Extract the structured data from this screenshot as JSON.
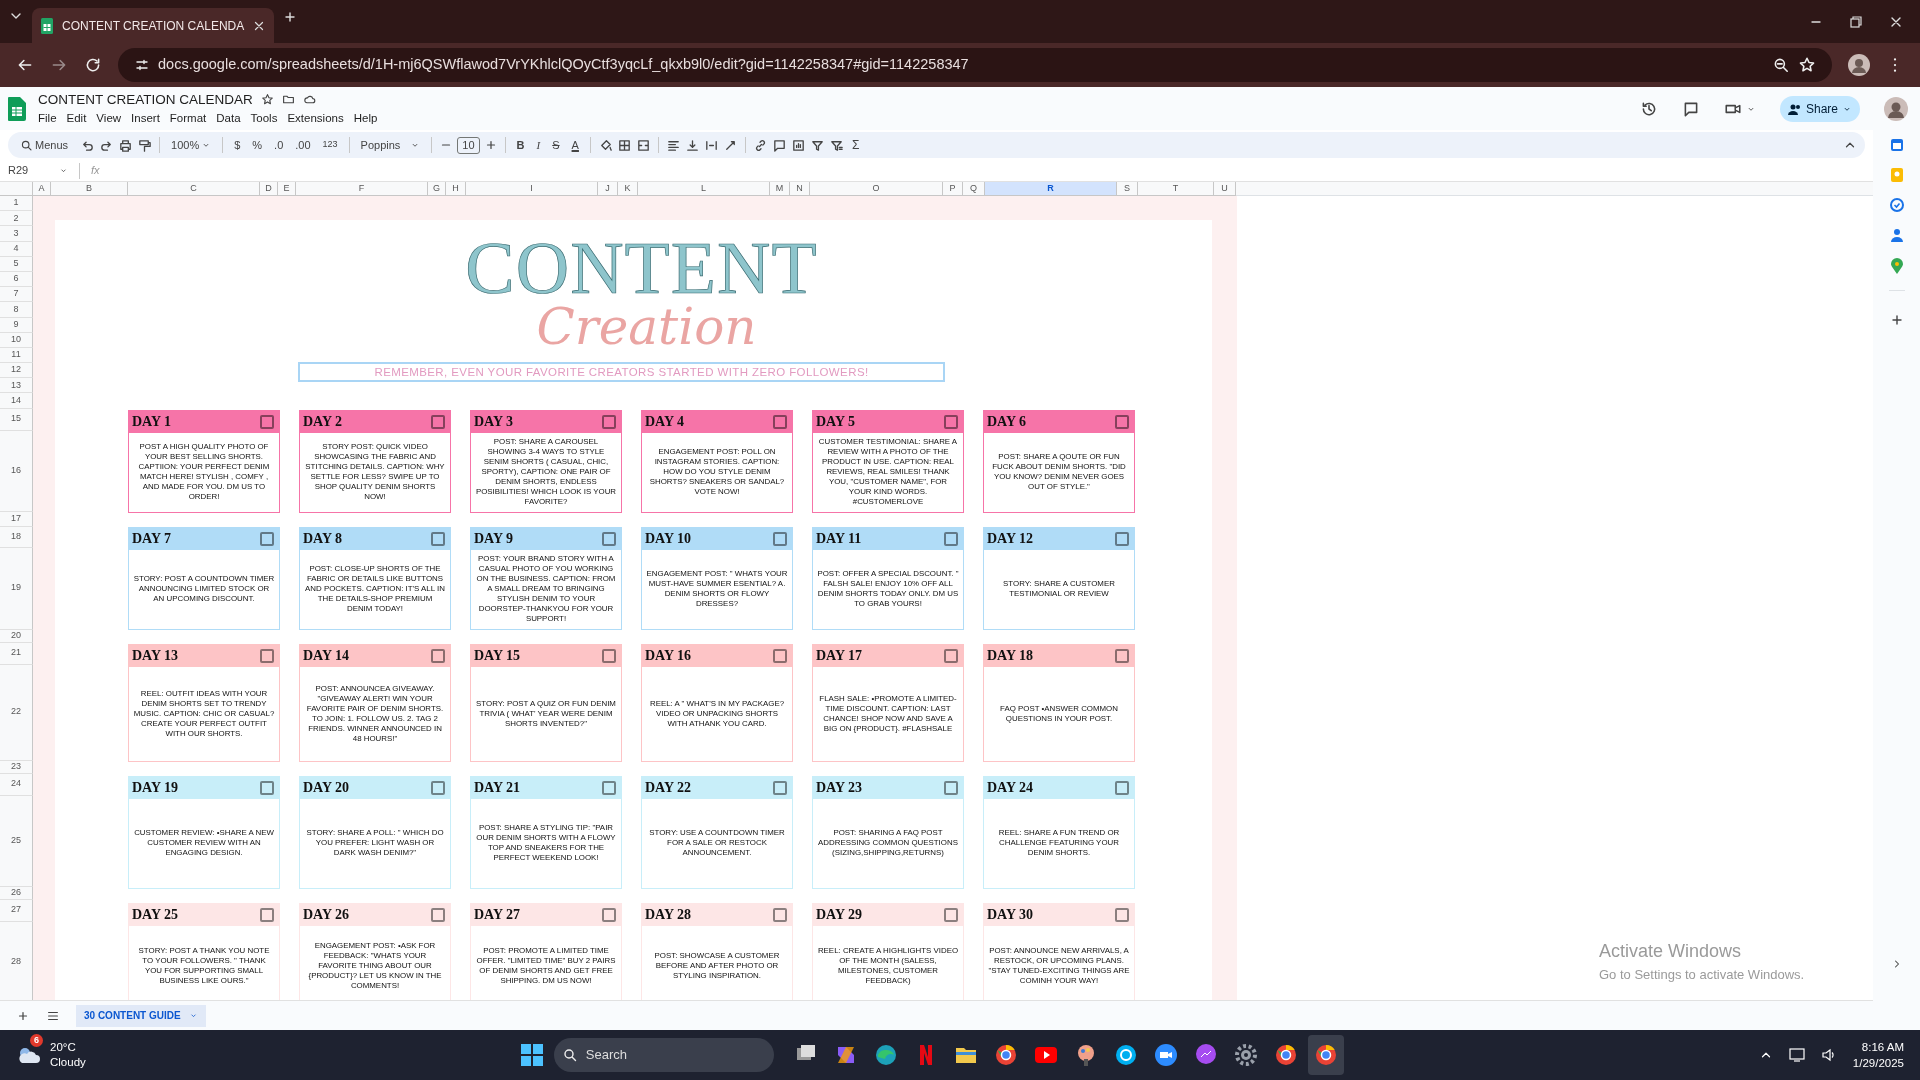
{
  "browser": {
    "tab_title": "CONTENT CREATION CALENDA",
    "url": "docs.google.com/spreadsheets/d/1H-mj6QSWflawod7VrYKhlclQOyCtf3yqcLf_qkxb9l0/edit?gid=1142258347#gid=1142258347"
  },
  "app": {
    "title": "CONTENT CREATION CALENDAR",
    "menu": [
      "File",
      "Edit",
      "View",
      "Insert",
      "Format",
      "Data",
      "Tools",
      "Extensions",
      "Help"
    ],
    "share_label": "Share"
  },
  "toolbar": {
    "search_label": "Menus",
    "zoom": "100%",
    "currency": "$",
    "percent": "%",
    "decrease_decimal": ".0",
    "increase_decimal": ".00",
    "number_format": "123",
    "font": "Poppins",
    "font_size": "10",
    "bold": "B",
    "italic": "I",
    "strikethrough": "S",
    "text_color": "A",
    "functions": "Σ"
  },
  "formula_bar": {
    "cell_ref": "R29",
    "fx": "fx"
  },
  "columns": [
    {
      "label": "A",
      "selected": false
    },
    {
      "label": "B",
      "selected": false
    },
    {
      "label": "C",
      "selected": false
    },
    {
      "label": "D",
      "selected": false
    },
    {
      "label": "E",
      "selected": false
    },
    {
      "label": "F",
      "selected": false
    },
    {
      "label": "G",
      "selected": false
    },
    {
      "label": "H",
      "selected": false
    },
    {
      "label": "I",
      "selected": false
    },
    {
      "label": "J",
      "selected": false
    },
    {
      "label": "K",
      "selected": false
    },
    {
      "label": "L",
      "selected": false
    },
    {
      "label": "M",
      "selected": false
    },
    {
      "label": "N",
      "selected": false
    },
    {
      "label": "O",
      "selected": false
    },
    {
      "label": "P",
      "selected": false
    },
    {
      "label": "Q",
      "selected": false
    },
    {
      "label": "R",
      "selected": true
    },
    {
      "label": "S",
      "selected": false
    },
    {
      "label": "T",
      "selected": false
    },
    {
      "label": "U",
      "selected": false
    }
  ],
  "row_numbers": [
    "1",
    "2",
    "3",
    "4",
    "5",
    "6",
    "7",
    "8",
    "9",
    "10",
    "11",
    "12",
    "13",
    "14",
    "15",
    "16",
    "17",
    "18",
    "19",
    "20",
    "21",
    "22",
    "23",
    "24",
    "25",
    "26",
    "27",
    "28"
  ],
  "page": {
    "title": "CONTENT",
    "subtitle": "Creation",
    "banner": "REMEMBER, EVEN YOUR FAVORITE CREATORS STARTED WITH ZERO FOLLOWERS!"
  },
  "weeks": [
    {
      "color": "#f674a8",
      "days": [
        {
          "label": "DAY 1",
          "text": "POST A HIGH QUALITY PHOTO OF YOUR BEST SELLING SHORTS. CAPTIION: YOUR PERFECT DENIM MATCH HERE! STYLISH , COMFY , AND MADE FOR YOU. DM US TO ORDER!",
          "checked": false
        },
        {
          "label": "DAY 2",
          "text": "STORY POST: QUICK VIDEO SHOWCASING THE FABRIC AND STITCHING DETAILS. CAPTION: WHY SETTLE FOR LESS? SWIPE UP TO SHOP QUALITY DENIM SHORTS NOW!",
          "checked": false
        },
        {
          "label": "DAY 3",
          "text": "POST: SHARE A CAROUSEL SHOWING 3-4 WAYS TO STYLE SENIM SHORTS ( CASUAL, CHIC, SPORTY), CAPTION: ONE PAIR OF DENIM SHORTS, ENDLESS POSIBILITIES! WHICH LOOK IS YOUR FAVORITE?",
          "checked": false
        },
        {
          "label": "DAY 4",
          "text": "ENGAGEMENT POST: POLL ON INSTAGRAM STORIES. CAPTION: HOW DO YOU STYLE DENIM SHORTS? SNEAKERS OR SANDAL? VOTE NOW!",
          "checked": false
        },
        {
          "label": "DAY 5",
          "text": "CUSTOMER TESTIMONIAL: SHARE A REVIEW WITH A PHOTO OF THE PRODUCT IN USE. CAPTION: REAL REVIEWS, REAL SMILES! THANK YOU, \"CUSTOMER NAME\", FOR YOUR KIND WORDS. #CUSTOMERLOVE",
          "checked": false
        },
        {
          "label": "DAY 6",
          "text": "POST: SHARE A QOUTE OR FUN FUCK ABOUT DENIM SHORTS. \"DID YOU KNOW? DENIM NEVER GOES OUT OF STYLE.\"",
          "checked": false
        }
      ]
    },
    {
      "color": "#b0dcf7",
      "days": [
        {
          "label": "DAY 7",
          "text": "STORY: POST A COUNTDOWN TIMER ANNOUNCING LIMITED STOCK OR AN UPCOMING DISCOUNT.",
          "checked": false
        },
        {
          "label": "DAY 8",
          "text": "POST: CLOSE-UP SHORTS OF THE FABRIC OR DETAILS LIKE BUTTONS AND POCKETS. CAPTION: IT'S ALL IN THE DETAILS-SHOP PREMIUM DENIM TODAY!",
          "checked": false
        },
        {
          "label": "DAY 9",
          "text": "POST: YOUR BRAND STORY WITH A CASUAL PHOTO OF YOU WORKING ON THE BUSINESS. CAPTION: FROM A SMALL DREAM TO BRINGING STYLISH DENIM TO YOUR DOORSTEP-THANKYOU FOR YOUR SUPPORT!",
          "checked": false
        },
        {
          "label": "DAY 10",
          "text": "ENGAGEMENT POST: \" WHATS YOUR MUST-HAVE SUMMER ESENTIAL? A. DENIM SHORTS OR FLOWY DRESSES?",
          "checked": false
        },
        {
          "label": "DAY 11",
          "text": "POST: OFFER A SPECIAL DSCOUNT. \" FALSH SALE! ENJOY 10% OFF ALL DENIM SHORTS TODAY ONLY. DM US TO GRAB YOURS!",
          "checked": false
        },
        {
          "label": "DAY 12",
          "text": "STORY: SHARE A CUSTOMER TESTIMONIAL OR REVIEW",
          "checked": false
        }
      ]
    },
    {
      "color": "#fdc4c6",
      "days": [
        {
          "label": "DAY 13",
          "text": "REEL: OUTFIT IDEAS WITH YOUR DENIM SHORTS SET TO TRENDY MUSIC. CAPTION: CHIC OR CASUAL? CREATE YOUR PERFECT OUTFIT WITH OUR SHORTS.",
          "checked": false
        },
        {
          "label": "DAY 14",
          "text": "POST: ANNOUNCEA GIVEAWAY. \"GIVEAWAY ALERT! WIN YOUR FAVORITE PAIR OF DENIM SHORTS. TO JOIN: 1. FOLLOW US. 2. TAG 2 FRIENDS. WINNER ANNOUNCED IN 48 HOURS!\"",
          "checked": false
        },
        {
          "label": "DAY 15",
          "text": "STORY: POST A QUIZ OR FUN DENIM TRIVIA ( WHAT' YEAR WERE DENIM SHORTS INVENTED?\"",
          "checked": false
        },
        {
          "label": "DAY 16",
          "text": "REEL: A \" WHAT'S IN MY PACKAGE? VIDEO OR UNPACKING SHORTS WITH ATHANK YOU CARD.",
          "checked": false
        },
        {
          "label": "DAY 17",
          "text": "FLASH SALE: •PROMOTE A LIMITED-TIME DISCOUNT. CAPTION: LAST CHANCE! SHOP NOW AND SAVE A BIG ON {PRODUCT}. #FLASHSALE",
          "checked": false
        },
        {
          "label": "DAY 18",
          "text": "FAQ POST •ANSWER COMMON QUESTIONS IN YOUR POST.",
          "checked": false
        }
      ]
    },
    {
      "color": "#c8eef9",
      "days": [
        {
          "label": "DAY 19",
          "text": "CUSTOMER REVIEW: •SHARE A NEW CUSTOMER REVIEW WITH AN ENGAGING DESIGN.",
          "checked": false
        },
        {
          "label": "DAY 20",
          "text": "STORY: SHARE A POLL: \" WHICH DO YOU PREFER: LIGHT WASH OR DARK WASH DENIM?\"",
          "checked": false
        },
        {
          "label": "DAY 21",
          "text": "POST: SHARE A STYLING TIP: \"PAIR OUR DENIM SHORTS WITH A FLOWY TOP AND SNEAKERS FOR THE PERFECT WEEKEND LOOK!",
          "checked": false
        },
        {
          "label": "DAY 22",
          "text": "STORY: USE A COUNTDOWN TIMER FOR A SALE OR RESTOCK ANNOUNCEMENT.",
          "checked": false
        },
        {
          "label": "DAY 23",
          "text": "POST: SHARING A FAQ POST ADDRESSING COMMON QUESTIONS (SIZING,SHIPPING,RETURNS)",
          "checked": false
        },
        {
          "label": "DAY 24",
          "text": "REEL: SHARE A FUN TREND OR CHALLENGE FEATURING YOUR DENIM SHORTS.",
          "checked": false
        }
      ]
    },
    {
      "color": "#fde6e6",
      "days": [
        {
          "label": "DAY 25",
          "text": "STORY: POST A THANK YOU NOTE TO YOUR FOLLOWERS. \" THANK YOU FOR SUPPORTING SMALL BUSINESS LIKE OURS.\"",
          "checked": false
        },
        {
          "label": "DAY 26",
          "text": "ENGAGEMENT POST: •ASK FOR FEEDBACK: \"WHATS YOUR FAVORITE THING ABOUT OUR {PRODUCT}? LET US KNOW IN THE COMMENTS!",
          "checked": false
        },
        {
          "label": "DAY 27",
          "text": "POST: PROMOTE A LIMITED TIME OFFER. \"LIMITED TIME\" BUY 2 PAIRS OF DENIM SHORTS AND GET FREE SHIPPING. DM US NOW!",
          "checked": false
        },
        {
          "label": "DAY 28",
          "text": "POST: SHOWCASE A CUSTOMER BEFORE AND AFTER PHOTO OR STYLING INSPIRATION.",
          "checked": false
        },
        {
          "label": "DAY 29",
          "text": "REEL: CREATE A HIGHLIGHTS VIDEO OF THE MONTH (SALESS, MILESTONES, CUSTOMER FEEDBACK)",
          "checked": false
        },
        {
          "label": "DAY 30",
          "text": "POST: ANNOUNCE NEW ARRIVALS, A RESTOCK, OR UPCOMING PLANS. \"STAY TUNED-EXCITING THINGS ARE COMINH YOUR WAY!",
          "checked": false
        }
      ]
    }
  ],
  "sheet_tabs": [
    {
      "label": "30 CONTENT GUIDE",
      "selected": true
    }
  ],
  "os_notice": {
    "title": "Activate Windows",
    "subtitle": "Go to Settings to activate Windows."
  },
  "taskbar": {
    "weather_badge": "6",
    "temperature": "20°C",
    "condition": "Cloudy",
    "search": "Search",
    "time": "8:16 AM",
    "date": "1/29/2025"
  }
}
